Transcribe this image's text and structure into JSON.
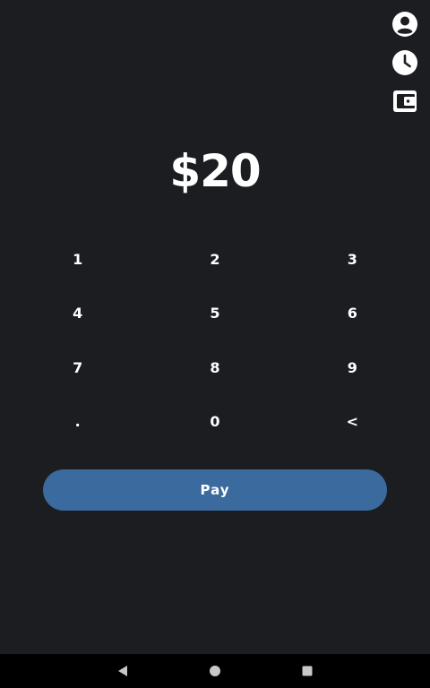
{
  "header": {
    "icons": [
      "account-icon",
      "clock-icon",
      "wallet-icon"
    ]
  },
  "amount": {
    "display": "$20"
  },
  "keypad": {
    "keys": [
      "1",
      "2",
      "3",
      "4",
      "5",
      "6",
      "7",
      "8",
      "9",
      ".",
      "0",
      "<"
    ]
  },
  "pay_button": {
    "label": "Pay"
  },
  "nav": {
    "icons": [
      "back-icon",
      "home-icon",
      "recents-icon"
    ]
  },
  "colors": {
    "background": "#1b1d21",
    "accent": "#3a6a9e",
    "text": "#ffffff",
    "nav_bar": "#000000"
  }
}
